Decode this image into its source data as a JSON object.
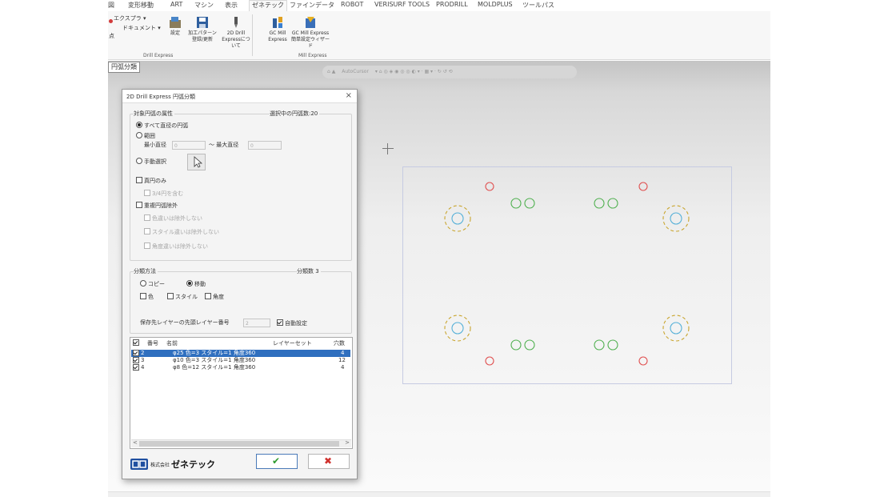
{
  "menu_tabs": [
    {
      "label": "図",
      "active": false
    },
    {
      "label": "変形移動",
      "active": false
    },
    {
      "label": "ART",
      "active": false
    },
    {
      "label": "マシン",
      "active": false
    },
    {
      "label": "表示",
      "active": false
    },
    {
      "label": "ゼネテック",
      "active": true
    },
    {
      "label": "ファインデータ",
      "active": false
    },
    {
      "label": "ROBOT",
      "active": false
    },
    {
      "label": "VERISURF TOOLS",
      "active": false
    },
    {
      "label": "PRODRILL",
      "active": false
    },
    {
      "label": "MOLDPLUS",
      "active": false
    },
    {
      "label": "ツールパス",
      "active": false
    }
  ],
  "ribbon": {
    "export_label": "エクスプラ",
    "document_label": "ドキュメント",
    "partial_label": "点",
    "settings_label": "設定",
    "pattern_label_1": "加工パターン",
    "pattern_label_2": "登録/更新",
    "about_label_1": "2D Drill",
    "about_label_2": "Expressについて",
    "gcmill_label_1": "GC Mill",
    "gcmill_label_2": "Express",
    "wizard_label_1": "GC Mill Express",
    "wizard_label_2": "簡単設定ウィザード",
    "group1_label": "Drill Express",
    "group2_label": "Mill Express"
  },
  "document_tab": "円弧分類",
  "canvas_toolbar": "AutoCursor",
  "dialog": {
    "title": "2D Drill Express 円弧分類",
    "close_symbol": "×",
    "target_section": "対象円弧の属性",
    "selected_count": "選択中の円弧数:20",
    "opt_all_diameters": "すべて直径の円弧",
    "opt_range": "範囲",
    "min_diameter_label": "最小直径",
    "min_diameter_value": "0",
    "max_diameter_label": "～ 最大直径",
    "max_diameter_value": "0",
    "opt_manual": "手動選択",
    "chk_full_circle": "真円のみ",
    "chk_three_quarter": "3/4円を含む",
    "chk_exclude_dup": "重複円弧除外",
    "chk_color_diff": "色違いは除外しない",
    "chk_style_diff": "スタイル違いは除外しない",
    "chk_angle_diff": "角度違いは除外しない",
    "classify_section": "分類方法",
    "classify_count": "分類数 3",
    "opt_copy": "コピー",
    "opt_move": "移動",
    "chk_color": "色",
    "chk_style": "スタイル",
    "chk_angle": "角度",
    "layer_label": "保存先レイヤーの先頭レイヤー番号",
    "layer_value": "2",
    "chk_auto": "自動設定",
    "list_headers": {
      "number": "番号",
      "name": "名前",
      "layer": "レイヤーセット",
      "holes": "穴数"
    },
    "rows": [
      {
        "number": "2",
        "name": "φ25 色=3 スタイル=1 角度360",
        "layer": "",
        "holes": "4",
        "selected": true
      },
      {
        "number": "3",
        "name": "φ10 色=3 スタイル=1 角度360",
        "layer": "",
        "holes": "12",
        "selected": false
      },
      {
        "number": "4",
        "name": "φ8 色=12 スタイル=1 角度360",
        "layer": "",
        "holes": "4",
        "selected": false
      }
    ],
    "scroll_left": "<",
    "scroll_right": ">",
    "logo_prefix": "株式会社",
    "logo_name": "ゼネテック",
    "ok_symbol": "✔",
    "cancel_symbol": "✖"
  },
  "colors": {
    "accent": "#2f6fbf",
    "ok_green": "#2e9b2e",
    "cancel_red": "#d0322e",
    "circle_red": "#e05050",
    "circle_green": "#4fb04f",
    "circle_cyan": "#56b0d8",
    "circle_yellow": "#c9a52e"
  }
}
